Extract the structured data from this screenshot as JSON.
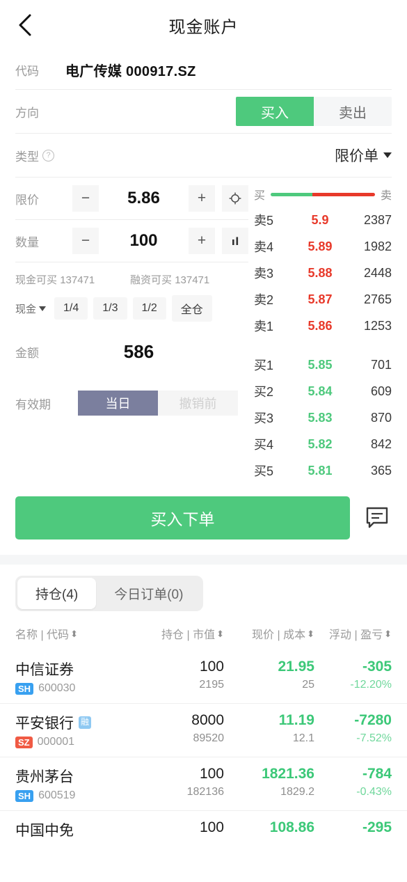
{
  "header": {
    "title": "现金账户",
    "back_icon": "chevron-left-icon"
  },
  "instrument": {
    "label": "代码",
    "value": "电广传媒 000917.SZ"
  },
  "direction": {
    "label": "方向",
    "options": [
      {
        "label": "买入",
        "selected": true
      },
      {
        "label": "卖出",
        "selected": false
      }
    ]
  },
  "order_type": {
    "label": "类型",
    "help_icon": "question-mark-icon",
    "value": "限价单",
    "caret_icon": "caret-down-icon"
  },
  "price": {
    "label": "限价",
    "minus": "−",
    "value": "5.86",
    "plus": "+",
    "extra_icon": "crosshair-target-icon"
  },
  "quantity": {
    "label": "数量",
    "minus": "−",
    "value": "100",
    "plus": "+",
    "extra_icon": "bar-chart-icon"
  },
  "available": {
    "cash_label": "现金可买",
    "cash_value": "137471",
    "margin_label": "融资可买",
    "margin_value": "137471"
  },
  "quick": {
    "account_selector": "现金",
    "caret_icon": "caret-down-icon",
    "buttons": [
      "1/4",
      "1/3",
      "1/2",
      "全仓"
    ]
  },
  "amount": {
    "label": "金额",
    "value": "586"
  },
  "validity": {
    "label": "有效期",
    "options": [
      {
        "label": "当日",
        "selected": true
      },
      {
        "label": "撤销前",
        "selected": false
      }
    ]
  },
  "order_book": {
    "buy_label": "买",
    "sell_label": "卖",
    "bar_buy_pct": 40,
    "bar_sell_pct": 60,
    "colors": {
      "buy": "#4ec97d",
      "sell": "#e8392a"
    },
    "asks": [
      {
        "tag": "卖5",
        "price": "5.9",
        "volume": "2387"
      },
      {
        "tag": "卖4",
        "price": "5.89",
        "volume": "1982"
      },
      {
        "tag": "卖3",
        "price": "5.88",
        "volume": "2448"
      },
      {
        "tag": "卖2",
        "price": "5.87",
        "volume": "2765"
      },
      {
        "tag": "卖1",
        "price": "5.86",
        "volume": "1253"
      }
    ],
    "bids": [
      {
        "tag": "买1",
        "price": "5.85",
        "volume": "701"
      },
      {
        "tag": "买2",
        "price": "5.84",
        "volume": "609"
      },
      {
        "tag": "买3",
        "price": "5.83",
        "volume": "870"
      },
      {
        "tag": "买4",
        "price": "5.82",
        "volume": "842"
      },
      {
        "tag": "买5",
        "price": "5.81",
        "volume": "365"
      }
    ]
  },
  "submit": {
    "label": "买入下单",
    "chat_icon": "chat-bubble-icon",
    "color": "#4ec97d"
  },
  "tabs": [
    {
      "label": "持仓(4)",
      "active": true
    },
    {
      "label": "今日订单(0)",
      "active": false
    }
  ],
  "table": {
    "columns": [
      {
        "label": "名称 | 代码",
        "sort_icon": "sort-updown-icon"
      },
      {
        "label": "持仓 | 市值",
        "sort_icon": "sort-updown-icon"
      },
      {
        "label": "现价 | 成本",
        "sort_icon": "sort-updown-icon"
      },
      {
        "label": "浮动 | 盈亏",
        "sort_icon": "sort-updown-icon"
      }
    ],
    "rows": [
      {
        "name": "中信证券",
        "tag": "",
        "exchange": "SH",
        "code": "600030",
        "position": "100",
        "market_value": "2195",
        "price": "21.95",
        "cost": "25",
        "pnl": "-305",
        "pnl_pct": "-12.20%"
      },
      {
        "name": "平安银行",
        "tag": "融",
        "exchange": "SZ",
        "code": "000001",
        "position": "8000",
        "market_value": "89520",
        "price": "11.19",
        "cost": "12.1",
        "pnl": "-7280",
        "pnl_pct": "-7.52%"
      },
      {
        "name": "贵州茅台",
        "tag": "",
        "exchange": "SH",
        "code": "600519",
        "position": "100",
        "market_value": "182136",
        "price": "1821.36",
        "cost": "1829.2",
        "pnl": "-784",
        "pnl_pct": "-0.43%"
      },
      {
        "name": "中国中免",
        "tag": "",
        "exchange": "",
        "code": "",
        "position": "100",
        "market_value": "",
        "price": "108.86",
        "cost": "",
        "pnl": "-295",
        "pnl_pct": ""
      }
    ]
  }
}
